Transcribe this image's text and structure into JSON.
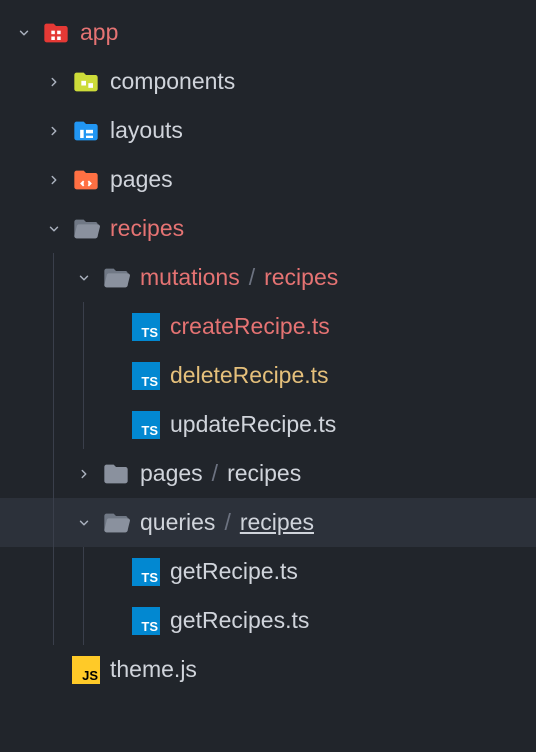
{
  "tree": {
    "app": "app",
    "components": "components",
    "layouts": "layouts",
    "pages": "pages",
    "recipes": "recipes",
    "mutations": "mutations",
    "mutations_sub": "recipes",
    "createRecipe": "createRecipe.ts",
    "deleteRecipe": "deleteRecipe.ts",
    "updateRecipe": "updateRecipe.ts",
    "pages_recipes": "pages",
    "pages_recipes_sub": "recipes",
    "queries": "queries",
    "queries_sub": "recipes",
    "getRecipe": "getRecipe.ts",
    "getRecipes": "getRecipes.ts",
    "theme": "theme.js"
  },
  "separator": "/"
}
